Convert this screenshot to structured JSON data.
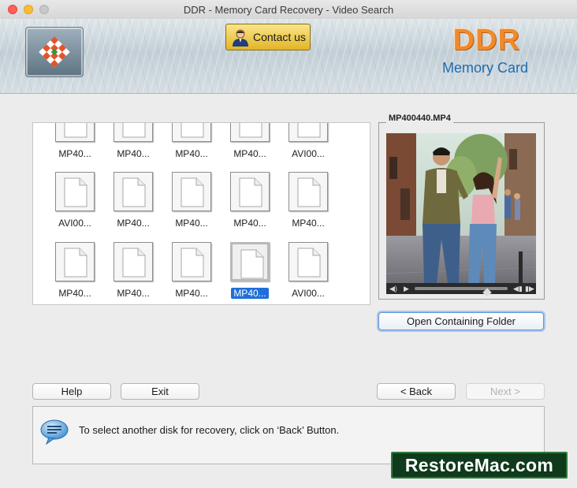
{
  "window": {
    "title": "DDR - Memory Card Recovery - Video Search"
  },
  "header": {
    "contact_label": "Contact us",
    "brand_line1": "DDR",
    "brand_line2": "Memory Card"
  },
  "files": {
    "row1": [
      "MP40...",
      "MP40...",
      "MP40...",
      "MP40...",
      "AVI00..."
    ],
    "row2": [
      "AVI00...",
      "MP40...",
      "MP40...",
      "MP40...",
      "MP40..."
    ],
    "row3": [
      "MP40...",
      "MP40...",
      "MP40...",
      "MP40...",
      "AVI00..."
    ],
    "selected": {
      "row": 3,
      "index": 4
    }
  },
  "preview": {
    "filename": "MP400440.MP4",
    "playback_position": 0.78,
    "open_folder_label": "Open Containing Folder"
  },
  "buttons": {
    "help": "Help",
    "exit": "Exit",
    "back": "< Back",
    "next": "Next >"
  },
  "info": {
    "message": "To select another disk for recovery, click on ‘Back’ Button."
  },
  "watermark": "RestoreMac.com",
  "colors": {
    "accent": "#1e6fd9",
    "brand_orange": "#f08a2a",
    "brand_blue": "#1d6cae",
    "contact_gold": "#e2b526"
  }
}
